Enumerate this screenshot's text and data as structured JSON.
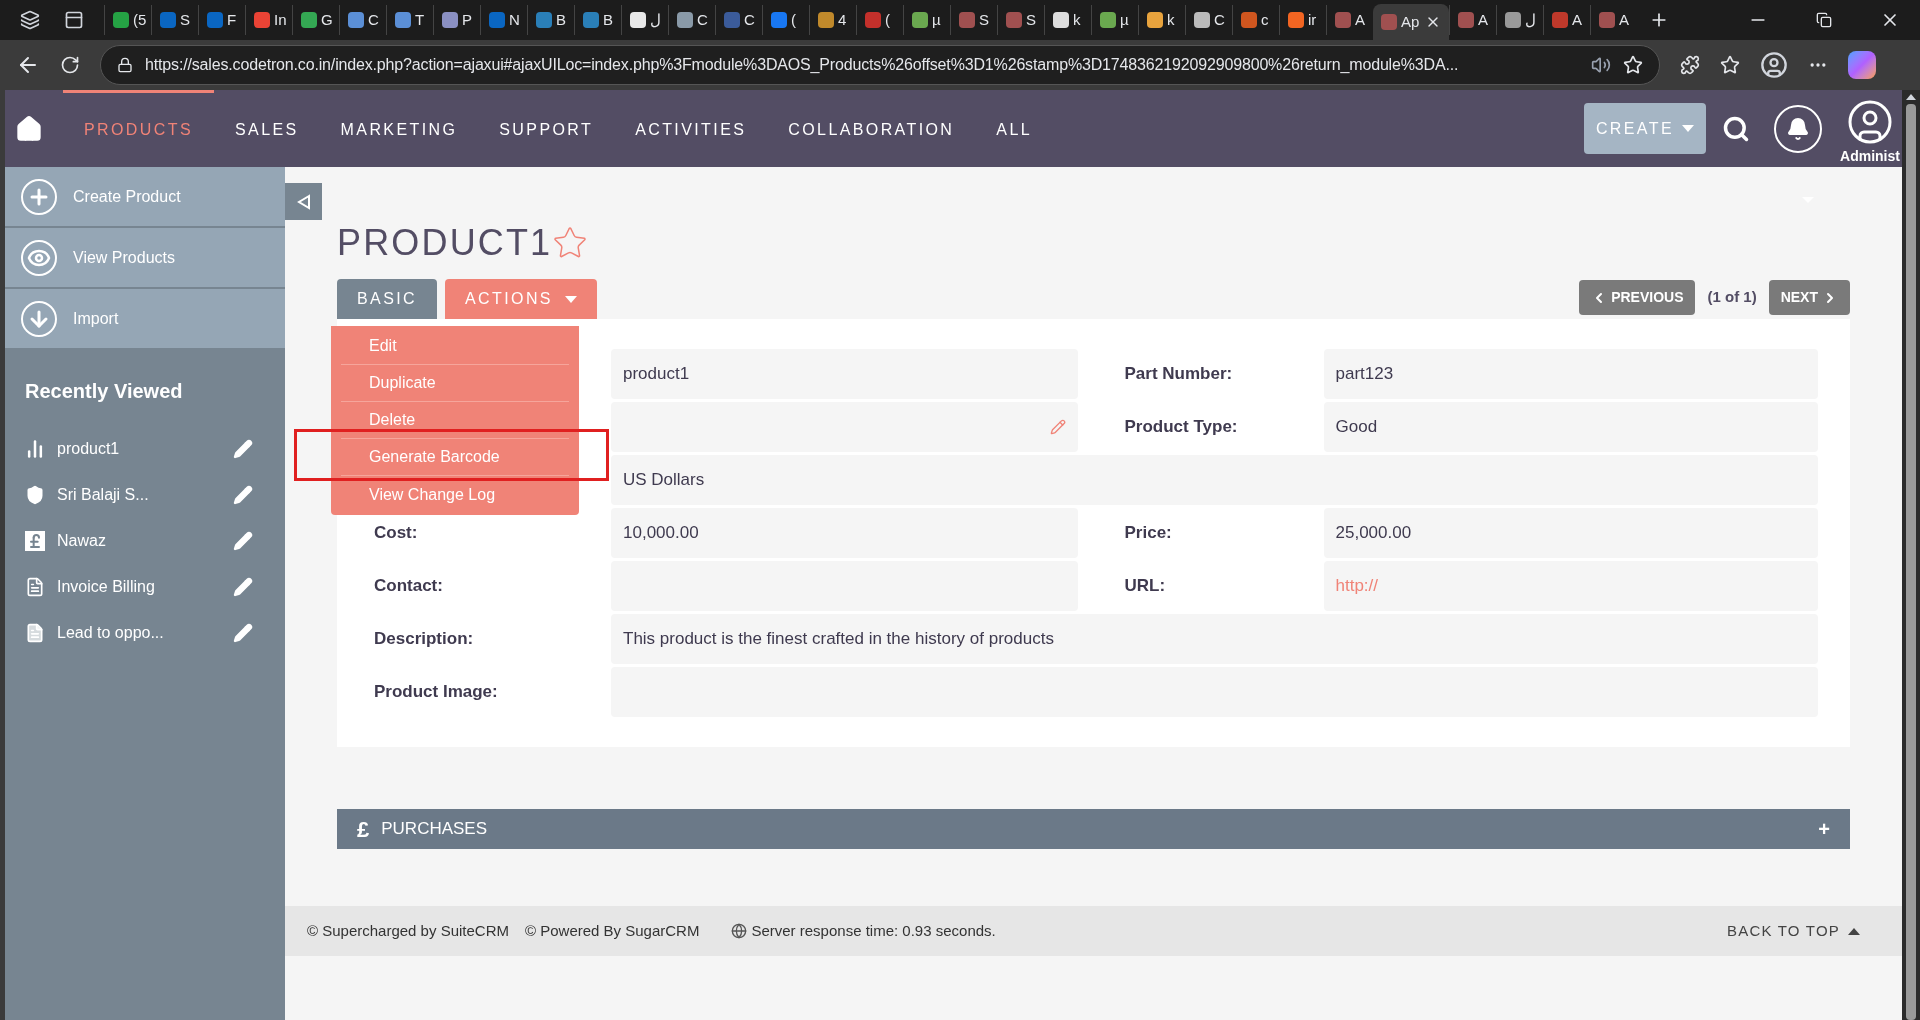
{
  "browser": {
    "tabs": [
      {
        "label": "(5",
        "color": "#25a244",
        "selected": false
      },
      {
        "label": "S",
        "color": "#0a66c2",
        "selected": false
      },
      {
        "label": "F",
        "color": "#0a66c2",
        "selected": false
      },
      {
        "label": "In",
        "color": "#ea4335",
        "selected": false
      },
      {
        "label": "G",
        "color": "#34a853",
        "selected": false
      },
      {
        "label": "C",
        "color": "#5b8fd6",
        "selected": false
      },
      {
        "label": "T",
        "color": "#5b8fd6",
        "selected": false
      },
      {
        "label": "P",
        "color": "#8a8fc2",
        "selected": false
      },
      {
        "label": "N",
        "color": "#0a66c2",
        "selected": false
      },
      {
        "label": "B",
        "color": "#2a7fb8",
        "selected": false
      },
      {
        "label": "B",
        "color": "#2a7fb8",
        "selected": false
      },
      {
        "label": "ل",
        "color": "#e8e8e8",
        "selected": false
      },
      {
        "label": "C",
        "color": "#8a9aa8",
        "selected": false
      },
      {
        "label": "C",
        "color": "#3b5b9a",
        "selected": false
      },
      {
        "label": "(",
        "color": "#1877f2",
        "selected": false
      },
      {
        "label": "4",
        "color": "#c0892b",
        "selected": false
      },
      {
        "label": "(",
        "color": "#c4302b",
        "selected": false
      },
      {
        "label": "µ",
        "color": "#6aa84f",
        "selected": false
      },
      {
        "label": "S",
        "color": "#a05050",
        "selected": false
      },
      {
        "label": "S",
        "color": "#a05050",
        "selected": false
      },
      {
        "label": "k",
        "color": "#dddddd",
        "selected": false
      },
      {
        "label": "µ",
        "color": "#6aa84f",
        "selected": false
      },
      {
        "label": "k",
        "color": "#e8a33d",
        "selected": false
      },
      {
        "label": "C",
        "color": "#bbbbbb",
        "selected": false
      },
      {
        "label": "c",
        "color": "#d0561f",
        "selected": false
      },
      {
        "label": "ir",
        "color": "#f26522",
        "selected": false
      },
      {
        "label": "A",
        "color": "#a05050",
        "selected": false
      },
      {
        "label": "Ap",
        "color": "#a05050",
        "selected": true
      },
      {
        "label": "A",
        "color": "#a05050",
        "selected": false
      },
      {
        "label": "ل",
        "color": "#999999",
        "selected": false
      },
      {
        "label": "A",
        "color": "#c0392b",
        "selected": false
      },
      {
        "label": "A",
        "color": "#a05050",
        "selected": false
      }
    ],
    "address": "https://sales.codetron.co.in/index.php?action=ajaxui#ajaxUILoc=index.php%3Fmodule%3DAOS_Products%26offset%3D1%26stamp%3D1748362192092909800%26return_module%3DA..."
  },
  "nav": {
    "items": [
      {
        "label": "PRODUCTS",
        "selected": true
      },
      {
        "label": "SALES",
        "selected": false
      },
      {
        "label": "MARKETING",
        "selected": false
      },
      {
        "label": "SUPPORT",
        "selected": false
      },
      {
        "label": "ACTIVITIES",
        "selected": false
      },
      {
        "label": "COLLABORATION",
        "selected": false
      },
      {
        "label": "ALL",
        "selected": false
      }
    ],
    "create": "CREATE",
    "user": "Administ"
  },
  "sidebar": {
    "actions": [
      {
        "label": "Create Product",
        "kind": "create"
      },
      {
        "label": "View Products",
        "kind": "view"
      },
      {
        "label": "Import",
        "kind": "import"
      }
    ],
    "recent_title": "Recently Viewed",
    "recent": [
      {
        "label": "product1",
        "kind": "product"
      },
      {
        "label": "Sri Balaji S...",
        "kind": "account"
      },
      {
        "label": "Nawaz",
        "kind": "invoice"
      },
      {
        "label": "Invoice Billing",
        "kind": "pdf"
      },
      {
        "label": "Lead to oppo...",
        "kind": "document"
      }
    ]
  },
  "record": {
    "title": "PRODUCT1",
    "tabs": [
      {
        "label": "BASIC",
        "selected": false
      },
      {
        "label": "ACTIONS",
        "selected": true
      }
    ],
    "pagination": {
      "previous": "PREVIOUS",
      "count": "(1 of 1)",
      "next": "NEXT"
    },
    "actions_menu": [
      "Edit",
      "Duplicate",
      "Delete",
      "Generate Barcode",
      "View Change Log"
    ],
    "rows": [
      {
        "fields": [
          {
            "value": "product1",
            "kind": "text"
          },
          {
            "label": "Part Number:",
            "value": "part123",
            "kind": "text"
          }
        ]
      },
      {
        "fields": [
          {
            "kind": "editable"
          },
          {
            "label": "Product Type:",
            "value": "Good",
            "kind": "text"
          }
        ]
      },
      {
        "fields": [
          {
            "value": "US Dollars",
            "kind": "text"
          }
        ]
      },
      {
        "fields": [
          {
            "label": "Cost:",
            "value": "10,000.00",
            "kind": "text"
          },
          {
            "label": "Price:",
            "value": "25,000.00",
            "kind": "text"
          }
        ]
      },
      {
        "fields": [
          {
            "label": "Contact:",
            "kind": "text"
          },
          {
            "label": "URL:",
            "value": "http://",
            "kind": "link"
          }
        ]
      },
      {
        "fields": [
          {
            "label": "Description:",
            "value": "This product is the finest crafted in the history of products",
            "kind": "text"
          }
        ]
      },
      {
        "fields": [
          {
            "label": "Product Image:",
            "kind": "text"
          }
        ]
      }
    ]
  },
  "subpanel": {
    "symbol": "£",
    "title": "PURCHASES",
    "expand": "+"
  },
  "footer": {
    "supercharged": "© Supercharged by SuiteCRM",
    "powered": "© Powered By SugarCRM",
    "response": "Server response time: 0.93 seconds.",
    "back_to_top": "BACK TO TOP"
  }
}
